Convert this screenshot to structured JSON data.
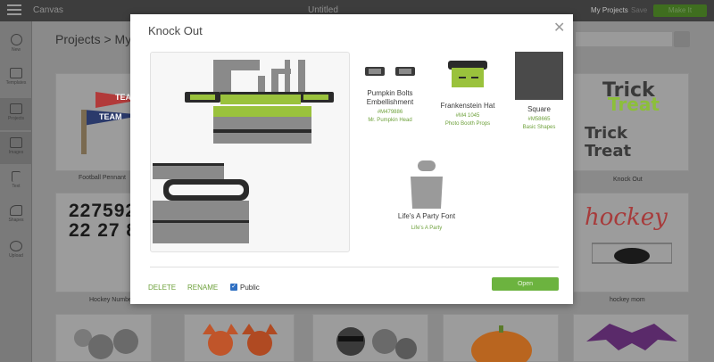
{
  "topbar": {
    "app_name": "Canvas",
    "document_title": "Untitled",
    "my_projects": "My Projects",
    "save": "Save",
    "make_it": "Make It"
  },
  "rail": {
    "items": [
      {
        "label": "New",
        "icon": "plus-icon"
      },
      {
        "label": "Templates",
        "icon": "shirt-icon"
      },
      {
        "label": "Projects",
        "icon": "projects-icon"
      },
      {
        "label": "Images",
        "icon": "image-icon"
      },
      {
        "label": "Text",
        "icon": "text-icon"
      },
      {
        "label": "Shapes",
        "icon": "shapes-icon"
      },
      {
        "label": "Upload",
        "icon": "upload-icon"
      }
    ]
  },
  "background": {
    "title": "Projects  >  My",
    "cards": [
      {
        "label": "Football Pennant"
      },
      {
        "label": "Knock Out"
      },
      {
        "label": "Hockey Number"
      },
      {
        "label": "hockey mom"
      }
    ],
    "pennant_texts": [
      "TEAM",
      "TEAM"
    ],
    "numbers": [
      "227592",
      "22 27 8"
    ],
    "hockey_text": "hockey"
  },
  "modal": {
    "title": "Knock Out",
    "preview_text": {
      "word1": "Trick",
      "word2": "Treat"
    },
    "components": [
      {
        "name": "Pumpkin Bolts Embellishment",
        "code": "#M479886",
        "cartridge": "Mr. Pumpkin Head"
      },
      {
        "name": "Frankenstein Hat",
        "code": "#M4 1045",
        "cartridge": "Photo Booth Props"
      },
      {
        "name": "Square",
        "code": "#M58665",
        "cartridge": "Basic Shapes"
      },
      {
        "name": "Life's A Party Font",
        "code": "",
        "cartridge": "Life's A Party"
      }
    ],
    "delete": "DELETE",
    "rename": "RENAME",
    "public_label": "Public",
    "public_checked": true,
    "open": "Open"
  },
  "colors": {
    "accent": "#6cb33f",
    "link": "#6da03a",
    "checkbox": "#2f6fc2"
  }
}
